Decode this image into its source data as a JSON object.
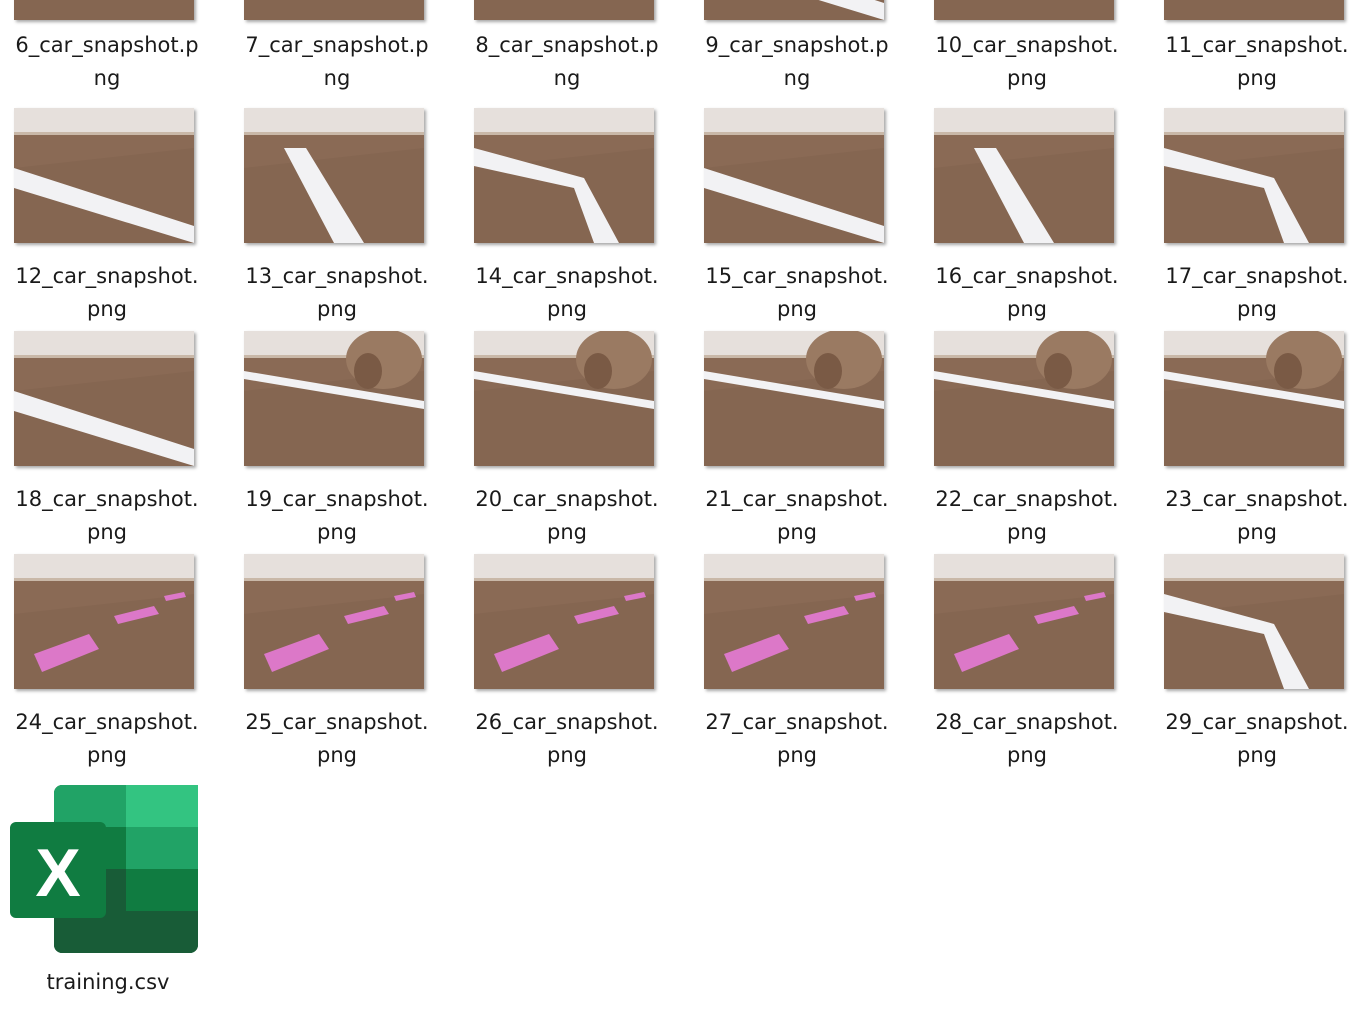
{
  "files": [
    {
      "name": "6_car_snapshot.png",
      "kind": "floor"
    },
    {
      "name": "7_car_snapshot.png",
      "kind": "floor"
    },
    {
      "name": "8_car_snapshot.png",
      "kind": "floor"
    },
    {
      "name": "9_car_snapshot.png",
      "kind": "tape"
    },
    {
      "name": "10_car_snapshot.png",
      "kind": "floor"
    },
    {
      "name": "11_car_snapshot.png",
      "kind": "floor"
    },
    {
      "name": "12_car_snapshot.png",
      "kind": "tape"
    },
    {
      "name": "13_car_snapshot.png",
      "kind": "tape"
    },
    {
      "name": "14_car_snapshot.png",
      "kind": "tape"
    },
    {
      "name": "15_car_snapshot.png",
      "kind": "tape"
    },
    {
      "name": "16_car_snapshot.png",
      "kind": "tape"
    },
    {
      "name": "17_car_snapshot.png",
      "kind": "tape"
    },
    {
      "name": "18_car_snapshot.png",
      "kind": "tape"
    },
    {
      "name": "19_car_snapshot.png",
      "kind": "bear"
    },
    {
      "name": "20_car_snapshot.png",
      "kind": "bear"
    },
    {
      "name": "21_car_snapshot.png",
      "kind": "bear"
    },
    {
      "name": "22_car_snapshot.png",
      "kind": "bear"
    },
    {
      "name": "23_car_snapshot.png",
      "kind": "bear"
    },
    {
      "name": "24_car_snapshot.png",
      "kind": "pink"
    },
    {
      "name": "25_car_snapshot.png",
      "kind": "pink"
    },
    {
      "name": "26_car_snapshot.png",
      "kind": "pink"
    },
    {
      "name": "27_car_snapshot.png",
      "kind": "pink"
    },
    {
      "name": "28_car_snapshot.png",
      "kind": "pink"
    },
    {
      "name": "29_car_snapshot.png",
      "kind": "tape"
    }
  ],
  "csv_file": {
    "name": "training.csv",
    "icon": "excel-icon",
    "icon_letter": "X"
  },
  "colors": {
    "floor": "#8a6a55",
    "wall": "#e6e0dc",
    "tape": "#f2f2f4",
    "pink": "#dc78c8",
    "bear": "#9a7a62",
    "excel_dark": "#107c41",
    "excel_light": "#33c481"
  }
}
